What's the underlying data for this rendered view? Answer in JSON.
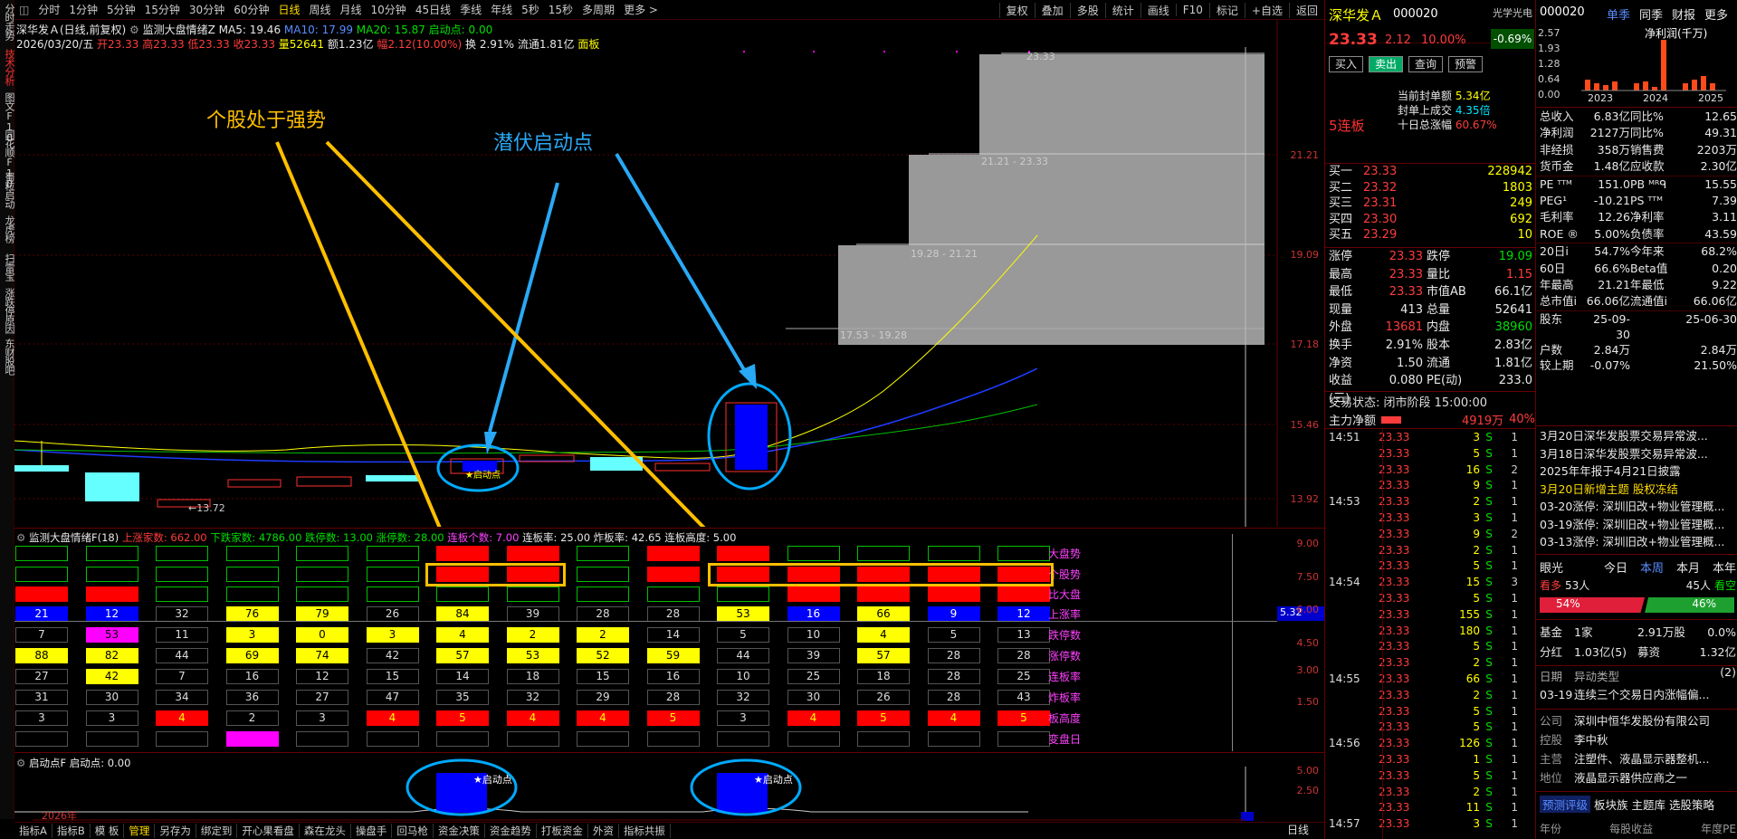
{
  "left_tabs": [
    "分时走势",
    "技术分析",
    "图文F10",
    "同花顺F10",
    "蜀粒启动",
    "龙虎榜",
    "扫雷宝",
    "涨跌停原因",
    "东财股吧"
  ],
  "left_tab_active": 1,
  "periods": [
    "分时",
    "1分钟",
    "5分钟",
    "15分钟",
    "30分钟",
    "60分钟",
    "日线",
    "周线",
    "月线",
    "10分钟",
    "45日线",
    "季线",
    "年线",
    "5秒",
    "15秒",
    "多周期",
    "更多 >"
  ],
  "period_selected": 6,
  "toolbar": [
    "复权",
    "叠加",
    "多股",
    "统计",
    "画线",
    "F10",
    "标记",
    "+自选",
    "返回"
  ],
  "header": {
    "stock": "深华发Ａ(日线,前复权)",
    "indicator": "监测大盘情绪Z",
    "ma5_label": "MA5: 19.46",
    "ma10_label": "MA10: 17.99",
    "ma20_label": "MA20: 15.87",
    "qidong": "启动点: 0.00",
    "date": "2026/03/20/五",
    "open": "开23.33",
    "high": "高23.33",
    "low": "低23.33",
    "close": "收23.33",
    "vol": "量52641",
    "amt": "额1.23亿",
    "chg": "幅2.12(10.00%)",
    "turnover": "换 2.91%",
    "float": "流通1.81亿",
    "board": "面板"
  },
  "annotations": {
    "strong": "个股处于强势",
    "latent": "潜伏启动点"
  },
  "price_axis": [
    "21.21",
    "19.09",
    "17.18",
    "15.46",
    "13.92"
  ],
  "chip_labels": [
    "23.33",
    "21.21 - 23.33",
    "19.28 - 21.21",
    "17.53 - 19.28"
  ],
  "low_label": "←13.72",
  "qidong_small": "★启动点",
  "mid": {
    "title": "监测大盘情绪F(18)",
    "up": "上涨家数: 662.00",
    "down": "下跌家数: 4786.00",
    "dt": "跌停数: 13.00",
    "zt": "涨停数: 28.00",
    "lb": "连板个数: 7.00",
    "lbl": "连板率: 25.00",
    "zbl": "炸板率: 42.65",
    "lbh": "连板高度: 5.00",
    "axis": [
      "9.00",
      "7.50",
      "6.00",
      "4.50",
      "3.00",
      "1.50"
    ],
    "marker": "5.32",
    "row_labels": [
      "大盘势",
      "个股势",
      "比大盘",
      "上涨率",
      "跌停数",
      "涨停数",
      "连板率",
      "炸板率",
      "板高度",
      "变盘日"
    ],
    "rows": [
      {
        "colors": [
          "g",
          "g",
          "g",
          "g",
          "g",
          "g",
          "r",
          "r",
          "g",
          "r",
          "r",
          "g",
          "g",
          "g",
          "g"
        ],
        "vals": [
          "",
          "",
          "",
          "",
          "",
          "",
          "",
          "",
          "",
          "",
          "",
          "",
          "",
          "",
          ""
        ]
      },
      {
        "colors": [
          "g",
          "g",
          "g",
          "g",
          "g",
          "g",
          "r",
          "r",
          "g",
          "r",
          "r",
          "r",
          "r",
          "r",
          "r"
        ],
        "vals": [
          "",
          "",
          "",
          "",
          "",
          "",
          "",
          "",
          "",
          "",
          "",
          "",
          "",
          "",
          ""
        ]
      },
      {
        "colors": [
          "r",
          "r",
          "g",
          "g",
          "g",
          "g",
          "g",
          "g",
          "g",
          "g",
          "g",
          "r",
          "r",
          "r",
          "r"
        ],
        "vals": [
          "",
          "",
          "",
          "",
          "",
          "",
          "",
          "",
          "",
          "",
          "",
          "",
          "",
          "",
          ""
        ]
      },
      {
        "colors": [
          "b",
          "b",
          "n",
          "y",
          "y",
          "n",
          "y",
          "n",
          "n",
          "n",
          "y",
          "b",
          "y",
          "b",
          "b"
        ],
        "vals": [
          "21",
          "12",
          "32",
          "76",
          "79",
          "26",
          "84",
          "39",
          "28",
          "28",
          "53",
          "16",
          "66",
          "9",
          "12"
        ]
      },
      {
        "colors": [
          "n",
          "m",
          "n",
          "y",
          "y",
          "y",
          "y",
          "y",
          "y",
          "n",
          "n",
          "n",
          "y",
          "n",
          "n"
        ],
        "vals": [
          "7",
          "53",
          "11",
          "3",
          "0",
          "3",
          "4",
          "2",
          "2",
          "14",
          "5",
          "10",
          "4",
          "5",
          "13"
        ]
      },
      {
        "colors": [
          "y",
          "y",
          "n",
          "y",
          "y",
          "n",
          "y",
          "y",
          "y",
          "y",
          "n",
          "n",
          "y",
          "n",
          "n"
        ],
        "vals": [
          "88",
          "82",
          "44",
          "69",
          "74",
          "42",
          "57",
          "53",
          "52",
          "59",
          "44",
          "39",
          "57",
          "28",
          "28"
        ]
      },
      {
        "colors": [
          "n",
          "y",
          "n",
          "n",
          "n",
          "n",
          "n",
          "n",
          "n",
          "n",
          "n",
          "n",
          "n",
          "n",
          "n"
        ],
        "vals": [
          "27",
          "42",
          "7",
          "16",
          "12",
          "15",
          "14",
          "18",
          "15",
          "16",
          "10",
          "25",
          "18",
          "28",
          "25"
        ]
      },
      {
        "colors": [
          "n",
          "n",
          "n",
          "n",
          "n",
          "n",
          "n",
          "n",
          "n",
          "n",
          "n",
          "n",
          "n",
          "n",
          "n"
        ],
        "vals": [
          "31",
          "30",
          "34",
          "36",
          "27",
          "47",
          "35",
          "32",
          "29",
          "28",
          "32",
          "30",
          "26",
          "28",
          "43"
        ]
      },
      {
        "colors": [
          "n",
          "n",
          "r",
          "n",
          "n",
          "r",
          "r",
          "r",
          "r",
          "r",
          "n",
          "r",
          "r",
          "r",
          "r"
        ],
        "vals": [
          "3",
          "3",
          "4",
          "2",
          "3",
          "4",
          "5",
          "4",
          "4",
          "5",
          "3",
          "4",
          "5",
          "4",
          "5"
        ]
      },
      {
        "colors": [
          "n",
          "n",
          "n",
          "m",
          "n",
          "n",
          "n",
          "n",
          "n",
          "n",
          "n",
          "n",
          "n",
          "n",
          "n"
        ],
        "vals": [
          "",
          "",
          "",
          "",
          "",
          "",
          "",
          "",
          "",
          "",
          "",
          "",
          "",
          "",
          ""
        ]
      }
    ]
  },
  "bottom_ind": {
    "title": "启动点F",
    "val": "启动点: 0.00",
    "axis": [
      "5.00",
      "2.50"
    ],
    "label": "★启动点",
    "year": "2026年"
  },
  "bottom_tabs": [
    "指标A",
    "指标B",
    "模 板",
    "管理",
    "另存为",
    "绑定到",
    "开心果看盘",
    "森在龙头",
    "操盘手",
    "回马枪",
    "资金决策",
    "资金趋势",
    "打板资金",
    "外资",
    "指标共振"
  ],
  "bottom_tab_sel": 3,
  "bottom_right": "日线",
  "quote": {
    "name": "深华发Ａ",
    "code": "000020",
    "badge": "光学光电",
    "badge_pct": "-0.69%",
    "price": "23.33",
    "chg": "2.12",
    "pct": "10.00%",
    "buy": "买入",
    "sell": "卖出",
    "query": "查询",
    "alert": "预警",
    "seal_amt_lbl": "当前封单额",
    "seal_amt": "5.34亿",
    "seal_deal_lbl": "封单上成交",
    "seal_deal": "4.35倍",
    "ten_lbl": "十日总涨幅",
    "ten": "60.67%",
    "lianban": "5连板",
    "bids": [
      [
        "买一",
        "23.33",
        "228942"
      ],
      [
        "买二",
        "23.32",
        "1803"
      ],
      [
        "买三",
        "23.31",
        "249"
      ],
      [
        "买四",
        "23.30",
        "692"
      ],
      [
        "买五",
        "23.29",
        "10"
      ]
    ],
    "stats": [
      [
        "涨停",
        "23.33",
        "跌停",
        "19.09"
      ],
      [
        "最高",
        "23.33",
        "量比",
        "1.15"
      ],
      [
        "最低",
        "23.33",
        "市值AB",
        "66.1亿"
      ],
      [
        "现量",
        "413",
        "总量",
        "52641"
      ],
      [
        "外盘",
        "13681",
        "内盘",
        "38960"
      ],
      [
        "换手",
        "2.91%",
        "股本",
        "2.83亿"
      ],
      [
        "净资",
        "1.50",
        "流通",
        "1.81亿"
      ],
      [
        "收益(三)",
        "0.080",
        "PE(动)",
        "233.0"
      ]
    ],
    "state": "交易状态: 闭市阶段 15:00:00",
    "flow_lbl": "主力净额",
    "flow": "4919万",
    "flow_pct": "40%",
    "ticks": [
      [
        "14:51",
        "23.33",
        "3",
        "S",
        "1"
      ],
      [
        "",
        "23.33",
        "5",
        "S",
        "1"
      ],
      [
        "",
        "23.33",
        "16",
        "S",
        "2"
      ],
      [
        "",
        "23.33",
        "9",
        "S",
        "1"
      ],
      [
        "14:53",
        "23.33",
        "2",
        "S",
        "1"
      ],
      [
        "",
        "23.33",
        "3",
        "S",
        "1"
      ],
      [
        "",
        "23.33",
        "9",
        "S",
        "2"
      ],
      [
        "",
        "23.33",
        "2",
        "S",
        "1"
      ],
      [
        "",
        "23.33",
        "5",
        "S",
        "1"
      ],
      [
        "14:54",
        "23.33",
        "15",
        "S",
        "3"
      ],
      [
        "",
        "23.33",
        "5",
        "S",
        "1"
      ],
      [
        "",
        "23.33",
        "155",
        "S",
        "1"
      ],
      [
        "",
        "23.33",
        "180",
        "S",
        "1"
      ],
      [
        "",
        "23.33",
        "5",
        "S",
        "1"
      ],
      [
        "",
        "23.33",
        "2",
        "S",
        "1"
      ],
      [
        "14:55",
        "23.33",
        "66",
        "S",
        "1"
      ],
      [
        "",
        "23.33",
        "2",
        "S",
        "1"
      ],
      [
        "",
        "23.33",
        "5",
        "S",
        "1"
      ],
      [
        "",
        "23.33",
        "5",
        "S",
        "1"
      ],
      [
        "14:56",
        "23.33",
        "126",
        "S",
        "1"
      ],
      [
        "",
        "23.33",
        "1",
        "S",
        "1"
      ],
      [
        "",
        "23.33",
        "5",
        "S",
        "1"
      ],
      [
        "",
        "23.33",
        "2",
        "S",
        "1"
      ],
      [
        "",
        "23.33",
        "11",
        "S",
        "1"
      ],
      [
        "14:57",
        "23.33",
        "3",
        "S",
        "1"
      ]
    ]
  },
  "fund": {
    "code": "000020",
    "tabs": [
      "单季",
      "同季",
      "财报",
      "更多"
    ],
    "axis": [
      "2.57",
      "1.93",
      "1.28",
      "0.64",
      "0.00"
    ],
    "chart_title": "净利润(千万)",
    "years": [
      "2023",
      "2024",
      "2025"
    ],
    "rows": [
      [
        "总收入",
        "6.83亿",
        "同比%",
        "12.65"
      ],
      [
        "净利润",
        "2127万",
        "同比%",
        "49.31"
      ],
      [
        "非经损",
        "358万",
        "销售费",
        "2203万"
      ],
      [
        "货币金",
        "1.48亿",
        "应收款",
        "2.30亿"
      ],
      [
        "PE ᵀᵀᴹ",
        "151.0",
        "PB ᴹᴿᑫ",
        "15.55"
      ],
      [
        "PEG¹",
        "-10.21",
        "PS ᵀᵀᴹ",
        "7.39"
      ],
      [
        "毛利率",
        "12.26",
        "净利率",
        "3.11"
      ],
      [
        "ROE ®",
        "5.00%",
        "负债率",
        "43.59"
      ],
      [
        "20日i",
        "54.7%",
        "今年来",
        "68.2%"
      ],
      [
        "60日",
        "66.6%",
        "Beta值",
        "0.20"
      ],
      [
        "年最高",
        "21.21",
        "年最低",
        "9.22"
      ],
      [
        "总市值i",
        "66.06亿",
        "流通值i",
        "66.06亿"
      ],
      [
        "股东",
        "25-09-30",
        "",
        "25-06-30"
      ],
      [
        "户数",
        "2.84万",
        "",
        "2.84万"
      ],
      [
        "较上期",
        "-0.07%",
        "",
        "21.50%"
      ]
    ],
    "news": [
      "3月20日深华发股票交易异常波...",
      "3月18日深华发股票交易异常波...",
      "2025年年报于4月21日披露",
      "3月20日新增主题 股权冻结",
      "03-20涨停: 深圳旧改+物业管理概...",
      "03-19涨停: 深圳旧改+物业管理概...",
      "03-13涨停: 深圳旧改+物业管理概..."
    ],
    "eye": "眼光",
    "eye_tabs": [
      "今日",
      "本周",
      "本月",
      "本年"
    ],
    "bull": "看多",
    "bull_n": "53人",
    "bear_n": "45人",
    "bear": "看空",
    "bull_pct": "54%",
    "bear_pct": "46%",
    "info": [
      [
        "基金",
        "1家",
        "2.91万股",
        "0.0%"
      ],
      [
        "分红",
        "1.03亿(5)",
        "募资",
        "1.32亿(2)"
      ]
    ],
    "ab": [
      [
        "日期",
        "异动类型"
      ],
      [
        "03-19",
        "连续三个交易日内涨幅偏..."
      ]
    ],
    "company": [
      [
        "公司",
        "深圳中恒华发股份有限公司"
      ],
      [
        "控股",
        "李中秋"
      ],
      [
        "主营",
        "注塑件、液晶显示器整机..."
      ],
      [
        "地位",
        "液晶显示器供应商之一"
      ]
    ],
    "bottom_tabs": [
      "预测评级",
      "板块族",
      "主题库",
      "选股策略"
    ],
    "foot": [
      "年份",
      "每股收益",
      "年度PE"
    ]
  }
}
